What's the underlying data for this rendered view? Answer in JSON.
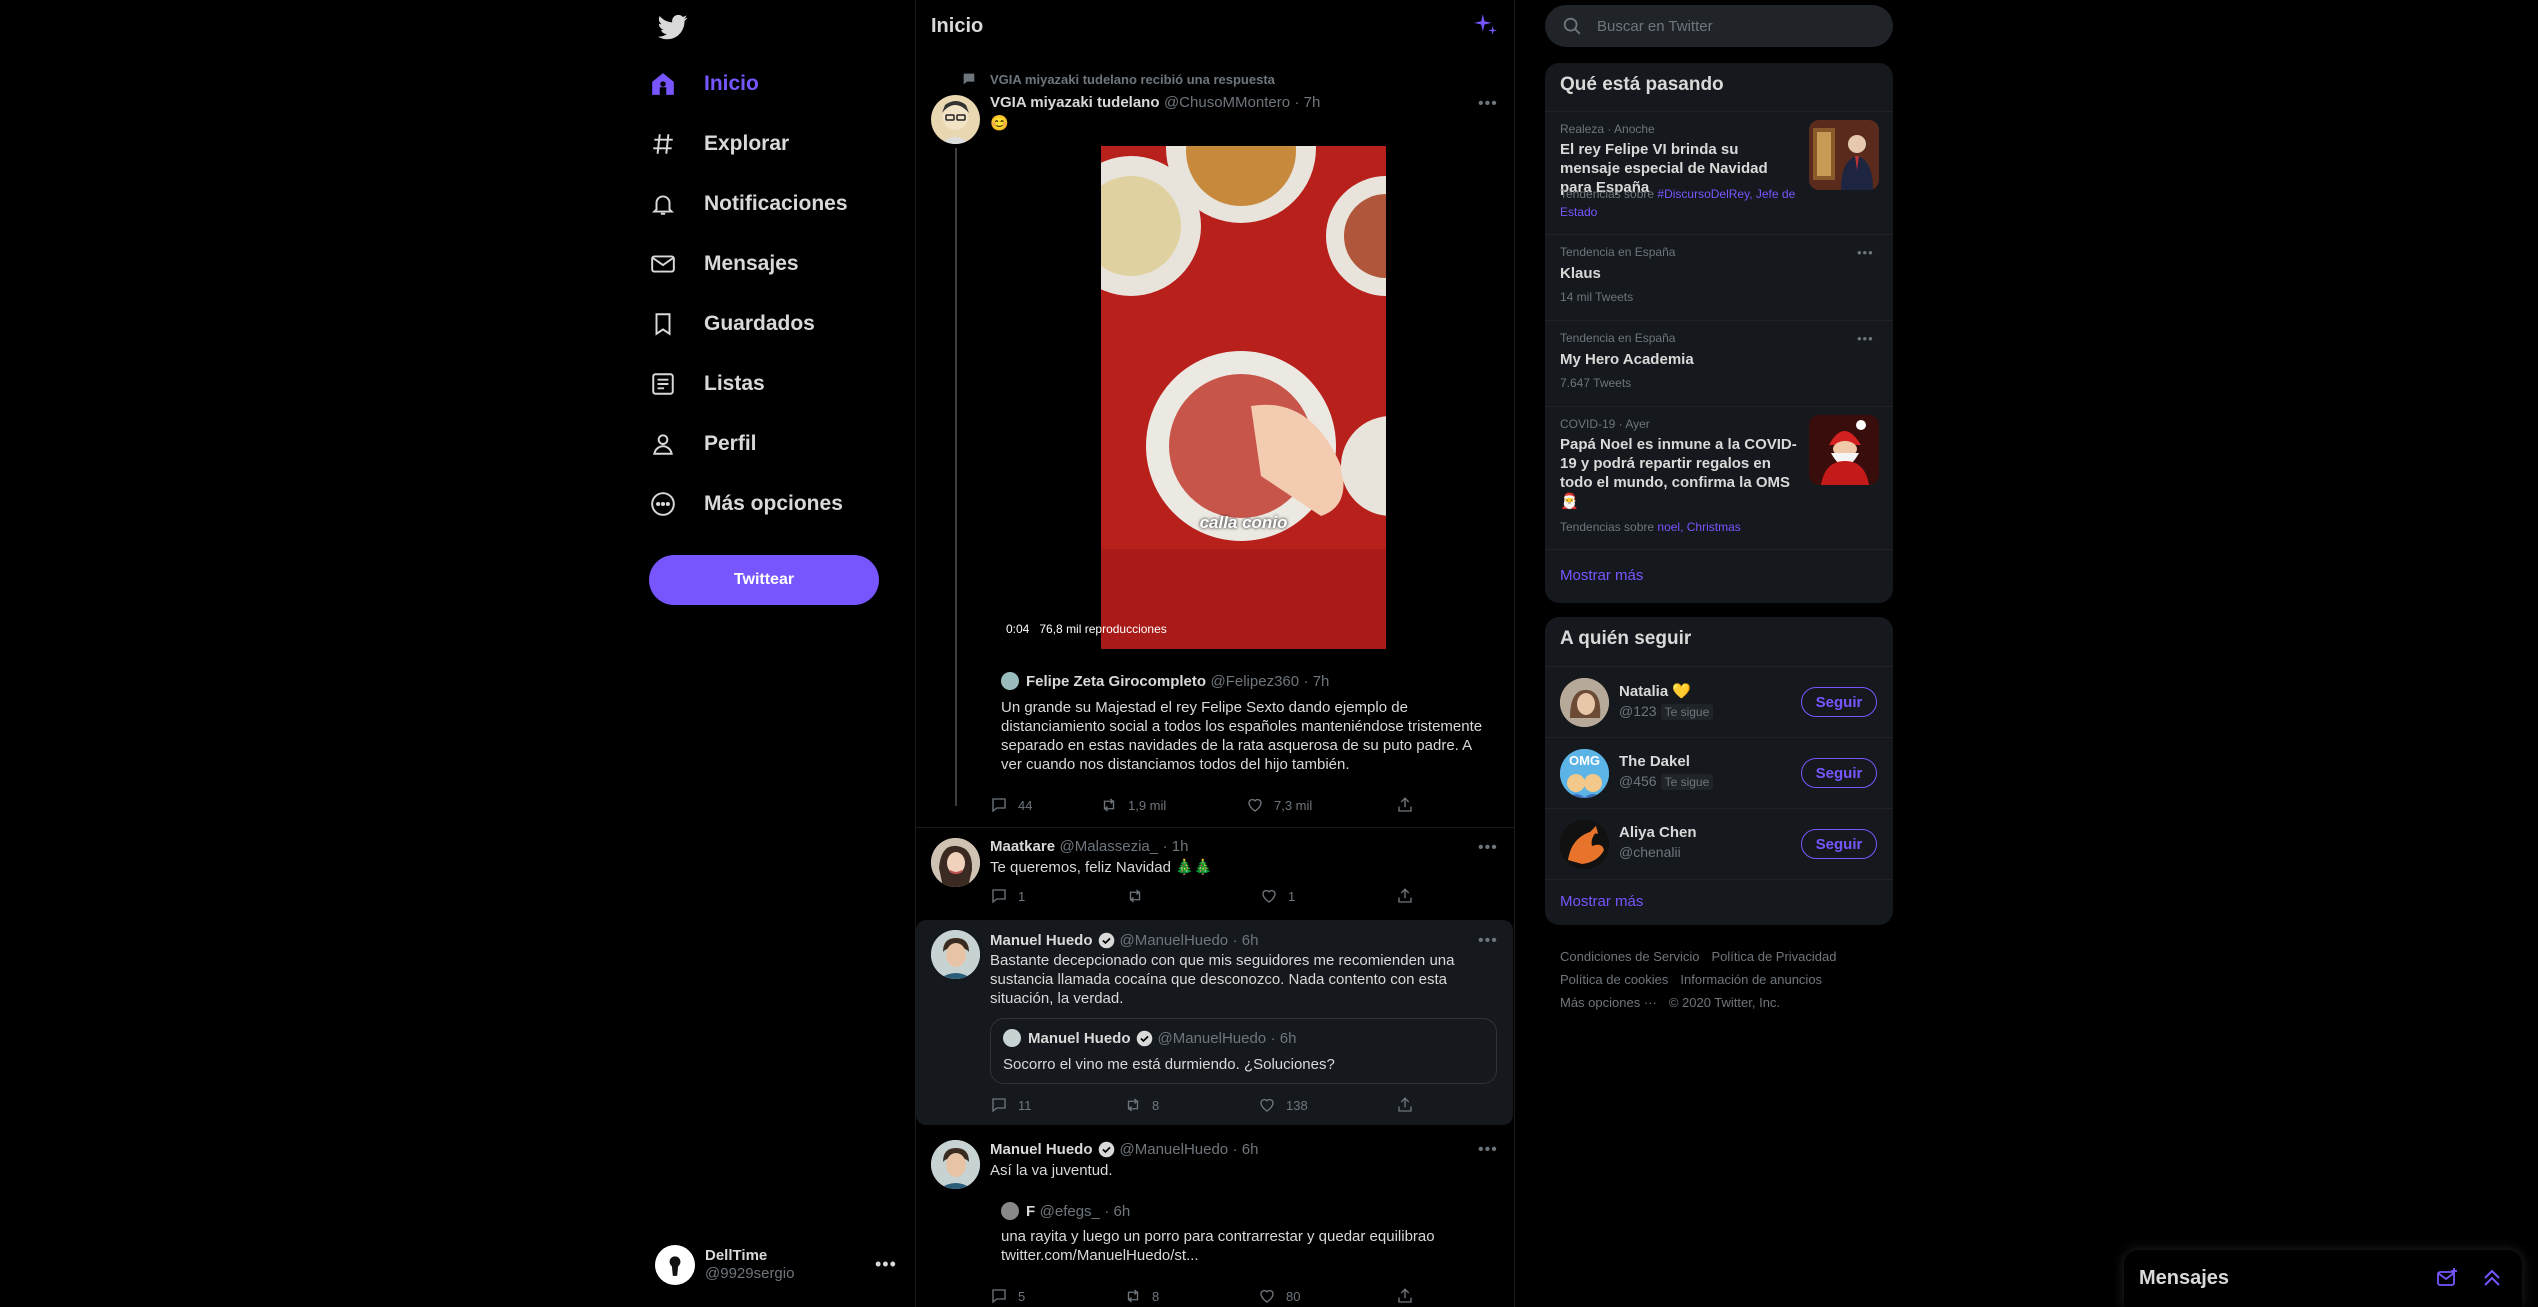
{
  "nav": {
    "items": [
      {
        "label": "Inicio",
        "icon": "home-icon",
        "active": true
      },
      {
        "label": "Explorar",
        "icon": "hashtag-icon"
      },
      {
        "label": "Notificaciones",
        "icon": "bell-icon"
      },
      {
        "label": "Mensajes",
        "icon": "mail-icon"
      },
      {
        "label": "Guardados",
        "icon": "bookmark-icon"
      },
      {
        "label": "Listas",
        "icon": "list-icon"
      },
      {
        "label": "Perfil",
        "icon": "user-icon"
      },
      {
        "label": "Más opciones",
        "icon": "more-circle-icon"
      }
    ],
    "tweet_button": "Twittear",
    "account": {
      "name": "DellTime",
      "handle": "@9929sergio"
    }
  },
  "header": {
    "title": "Inicio"
  },
  "tweets": {
    "t1": {
      "context": "VGIA miyazaki tudelano recibió una respuesta",
      "name": "VGIA miyazaki tudelano",
      "handle": "@ChusoMMontero",
      "time": "· 7h",
      "text": "😊",
      "video_caption": "calla conio",
      "video_time": "0:04",
      "video_views": "76,8 mil reproducciones",
      "quote": {
        "name": "Felipe Zeta Girocompleto",
        "handle": "@Felipez360",
        "time": "· 7h",
        "text": "Un grande su Majestad el rey Felipe Sexto dando ejemplo de distanciamiento social a todos los españoles manteniéndose tristemente separado en estas navidades de la rata asquerosa de su puto padre. A ver cuando nos distanciamos todos del hijo también."
      },
      "replies": "44",
      "retweets": "1,9 mil",
      "likes": "7,3 mil"
    },
    "t2": {
      "name": "Maatkare",
      "handle": "@Malassezia_",
      "time": "· 1h",
      "text": "Te queremos, feliz Navidad 🎄🎄",
      "replies": "1",
      "retweets": "",
      "likes": "1"
    },
    "t3": {
      "name": "Manuel Huedo",
      "handle": "@ManuelHuedo",
      "time": "· 6h",
      "text": "Bastante decepcionado con que mis seguidores me recomienden una sustancia llamada cocaína que desconozco. Nada contento con esta situación, la verdad.",
      "quote": {
        "name": "Manuel Huedo",
        "handle": "@ManuelHuedo",
        "time": "· 6h",
        "text": "Socorro el vino me está durmiendo. ¿Soluciones?"
      },
      "replies": "11",
      "retweets": "8",
      "likes": "138"
    },
    "t4": {
      "name": "Manuel Huedo",
      "handle": "@ManuelHuedo",
      "time": "· 6h",
      "text": "Así la va juventud.",
      "quote": {
        "name": "F",
        "handle": "@efegs_",
        "time": "· 6h",
        "text": "una rayita y luego un porro para contrarrestar y quedar equilibrao twitter.com/ManuelHuedo/st..."
      },
      "replies": "5",
      "retweets": "8",
      "likes": "80"
    }
  },
  "search": {
    "placeholder": "Buscar en Twitter"
  },
  "trends": {
    "title": "Qué está pasando",
    "items": [
      {
        "meta": "Realeza · Anoche",
        "title": "El rey Felipe VI brinda su mensaje especial de Navidad para España",
        "sub_prefix": "Tendencias sobre ",
        "sub_links": "#DiscursoDelRey, Jefe de Estado"
      },
      {
        "meta": "Tendencia en España",
        "title": "Klaus",
        "count": "14 mil Tweets"
      },
      {
        "meta": "Tendencia en España",
        "title": "My Hero Academia",
        "count": "7.647 Tweets"
      },
      {
        "meta": "COVID-19 · Ayer",
        "title": "Papá Noel es inmune a la COVID-19 y podrá repartir regalos en todo el mundo, confirma la OMS 🎅",
        "sub_prefix": "Tendencias sobre ",
        "sub_links": "noel, Christmas"
      }
    ],
    "show_more": "Mostrar más"
  },
  "follow": {
    "title": "A quién seguir",
    "users": [
      {
        "name": "Natalia 💛",
        "handle": "@123",
        "badge": "Te sigue",
        "button": "Seguir"
      },
      {
        "name": "The Dakel",
        "handle": "@456",
        "badge": "Te sigue",
        "button": "Seguir"
      },
      {
        "name": "Aliya Chen",
        "handle": "@chenalii",
        "badge": "",
        "button": "Seguir"
      }
    ],
    "show_more": "Mostrar más"
  },
  "footer": {
    "terms": "Condiciones de Servicio",
    "privacy": "Política de Privacidad",
    "cookies": "Política de cookies",
    "ads": "Información de anuncios",
    "more": "Más opciones ···",
    "copyright": "© 2020 Twitter, Inc."
  },
  "messages_drawer": {
    "title": "Mensajes"
  },
  "colors": {
    "accent": "#7856ff",
    "background": "#000000",
    "panel": "#15181c",
    "muted": "#6e767d"
  }
}
